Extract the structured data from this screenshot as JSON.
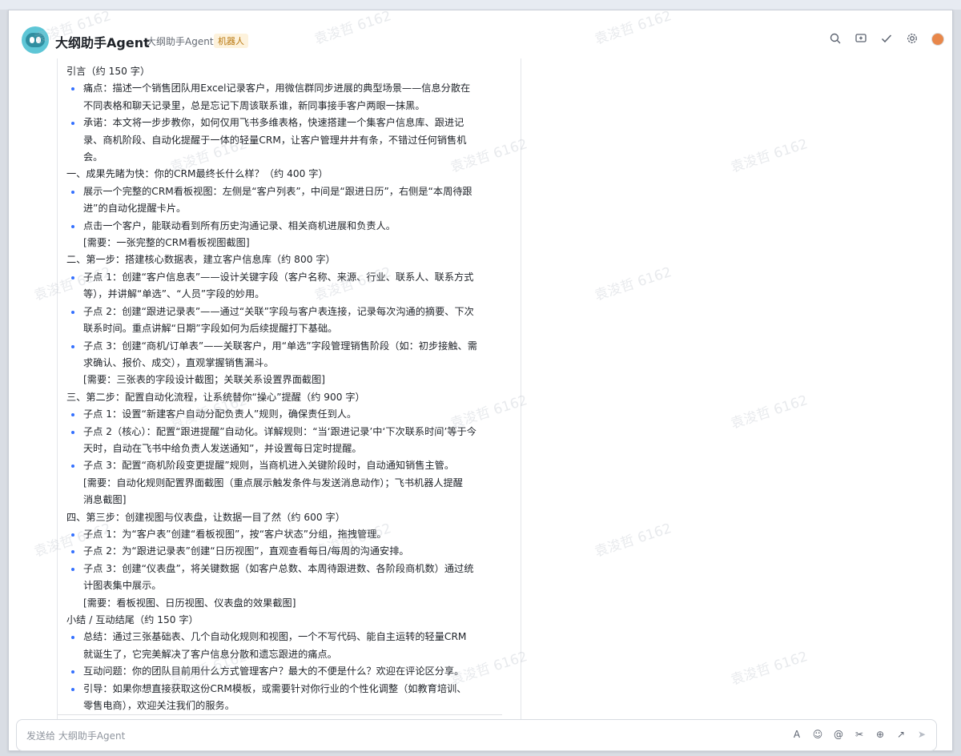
{
  "header": {
    "title": "大纲助手Agent",
    "subtitle": "大纲助手Agent",
    "badge": "机器人",
    "icons": [
      "search-icon",
      "screen-share-icon",
      "check-icon",
      "settings-icon",
      "user-avatar"
    ]
  },
  "outline": [
    {
      "kind": "section",
      "text": "引言（约 150 字）"
    },
    {
      "kind": "bullet",
      "text": "痛点：描述一个销售团队用Excel记录客户，用微信群同步进展的典型场景——信息分散在"
    },
    {
      "kind": "cont",
      "text": "不同表格和聊天记录里，总是忘记下周该联系谁，新同事接手客户两眼一抹黑。"
    },
    {
      "kind": "bullet",
      "text": "承诺：本文将一步步教你，如何仅用飞书多维表格，快速搭建一个集客户信息库、跟进记"
    },
    {
      "kind": "cont",
      "text": "录、商机阶段、自动化提醒于一体的轻量CRM，让客户管理井井有条，不错过任何销售机"
    },
    {
      "kind": "cont",
      "text": "会。"
    },
    {
      "kind": "section",
      "text": "一、成果先睹为快：你的CRM最终长什么样？（约 400 字）"
    },
    {
      "kind": "bullet",
      "text": "展示一个完整的CRM看板视图：左侧是“客户列表”，中间是“跟进日历”，右侧是“本周待跟"
    },
    {
      "kind": "cont",
      "text": "进”的自动化提醒卡片。"
    },
    {
      "kind": "bullet",
      "text": "点击一个客户，能联动看到所有历史沟通记录、相关商机进展和负责人。"
    },
    {
      "kind": "note",
      "text": "[需要：一张完整的CRM看板视图截图]"
    },
    {
      "kind": "section",
      "text": "二、第一步：搭建核心数据表，建立客户信息库（约 800 字）"
    },
    {
      "kind": "bullet",
      "text": "子点 1：创建“客户信息表”——设计关键字段（客户名称、来源、行业、联系人、联系方式"
    },
    {
      "kind": "cont",
      "text": "等），并讲解“单选”、“人员”字段的妙用。"
    },
    {
      "kind": "bullet",
      "text": "子点 2：创建“跟进记录表”——通过“关联”字段与客户表连接，记录每次沟通的摘要、下次"
    },
    {
      "kind": "cont",
      "text": "联系时间。重点讲解“日期”字段如何为后续提醒打下基础。"
    },
    {
      "kind": "bullet",
      "text": "子点 3：创建“商机/订单表”——关联客户，用“单选”字段管理销售阶段（如：初步接触、需"
    },
    {
      "kind": "cont",
      "text": "求确认、报价、成交），直观掌握销售漏斗。"
    },
    {
      "kind": "note",
      "text": "[需要：三张表的字段设计截图；关联关系设置界面截图]"
    },
    {
      "kind": "section",
      "text": "三、第二步：配置自动化流程，让系统替你“操心”提醒（约 900 字）"
    },
    {
      "kind": "bullet",
      "text": "子点 1：设置“新建客户自动分配负责人”规则，确保责任到人。"
    },
    {
      "kind": "bullet",
      "text": "子点 2（核心）：配置“跟进提醒”自动化。详解规则：“当‘跟进记录’中‘下次联系时间’等于今"
    },
    {
      "kind": "cont",
      "text": "天时，自动在飞书中给负责人发送通知”，并设置每日定时提醒。"
    },
    {
      "kind": "bullet",
      "text": "子点 3：配置“商机阶段变更提醒”规则，当商机进入关键阶段时，自动通知销售主管。"
    },
    {
      "kind": "note",
      "text": "[需要：自动化规则配置界面截图（重点展示触发条件与发送消息动作）；飞书机器人提醒"
    },
    {
      "kind": "cont",
      "text": "消息截图]"
    },
    {
      "kind": "section",
      "text": "四、第三步：创建视图与仪表盘，让数据一目了然（约 600 字）"
    },
    {
      "kind": "bullet",
      "text": "子点 1：为“客户表”创建“看板视图”，按“客户状态”分组，拖拽管理。"
    },
    {
      "kind": "bullet",
      "text": "子点 2：为“跟进记录表”创建“日历视图”，直观查看每日/每周的沟通安排。"
    },
    {
      "kind": "bullet",
      "text": "子点 3：创建“仪表盘”，将关键数据（如客户总数、本周待跟进数、各阶段商机数）通过统"
    },
    {
      "kind": "cont",
      "text": "计图表集中展示。"
    },
    {
      "kind": "note",
      "text": "[需要：看板视图、日历视图、仪表盘的效果截图]"
    },
    {
      "kind": "section",
      "text": "小结 / 互动结尾（约 150 字）"
    },
    {
      "kind": "bullet",
      "text": "总结：通过三张基础表、几个自动化规则和视图，一个不写代码、能自主运转的轻量CRM"
    },
    {
      "kind": "cont",
      "text": "就诞生了，它完美解决了客户信息分散和遗忘跟进的痛点。"
    },
    {
      "kind": "bullet",
      "text": "互动问题：你的团队目前用什么方式管理客户？最大的不便是什么？欢迎在评论区分享。"
    },
    {
      "kind": "bullet",
      "text": "引导：如果你想直接获取这份CRM模板，或需要针对你行业的个性化调整（如教育培训、"
    },
    {
      "kind": "cont",
      "text": "零售电商），欢迎关注我们的服务。"
    }
  ],
  "input": {
    "placeholder": "发送给 大纲助手Agent",
    "tools": [
      "font-icon",
      "emoji-icon",
      "at-icon",
      "scissors-icon",
      "add-icon",
      "expand-icon",
      "send-icon"
    ]
  },
  "watermark": "袁浚哲 6162"
}
